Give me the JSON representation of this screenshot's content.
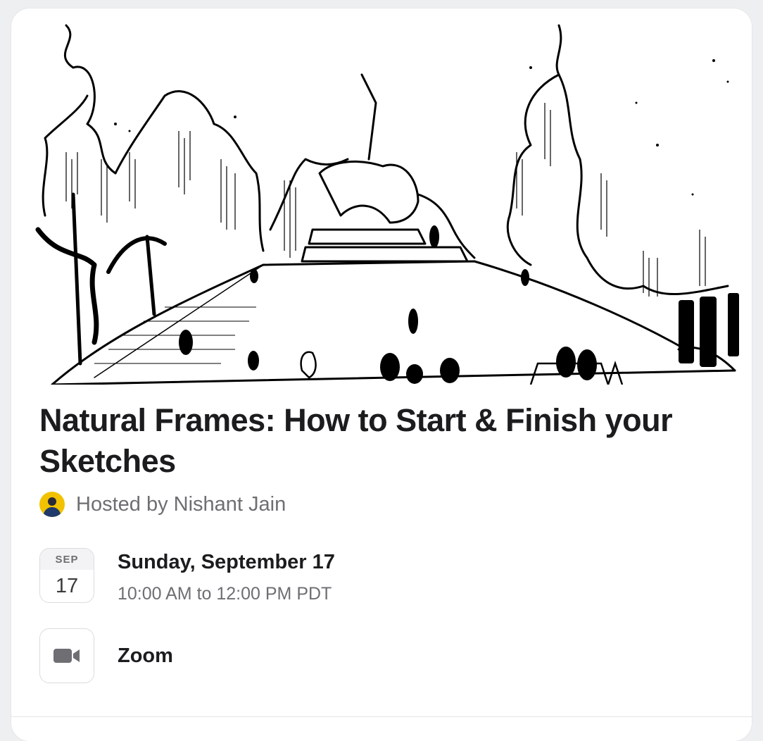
{
  "event": {
    "title": "Natural Frames: How to Start & Finish your Sketches",
    "host": "Hosted by Nishant Jain",
    "calendar_month": "SEP",
    "calendar_day": "17",
    "date": "Sunday, September 17",
    "time": "10:00 AM to 12:00 PM PDT",
    "location": "Zoom"
  },
  "icons": {
    "location": "video-camera-icon",
    "avatar": "host-avatar"
  },
  "colors": {
    "background": "#eeeff1",
    "card": "#ffffff",
    "title": "#1c1c1e",
    "muted": "#6e6e73",
    "avatar_bg": "#f2c200"
  }
}
